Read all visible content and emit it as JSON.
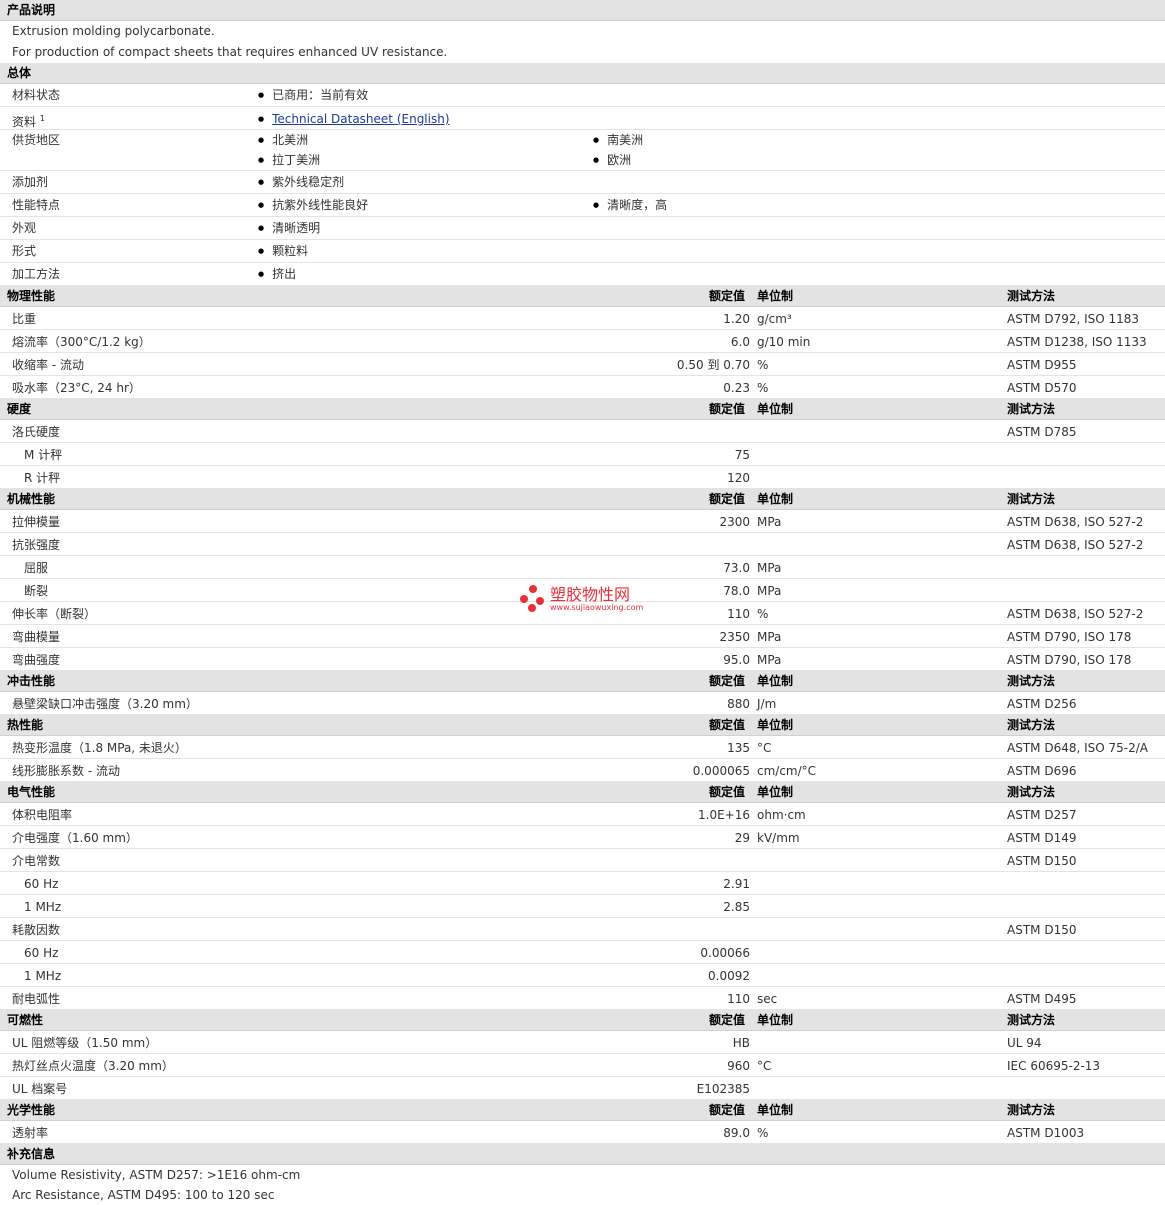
{
  "sections": {
    "desc": {
      "title": "产品说明",
      "lines": [
        "Extrusion molding polycarbonate.",
        "For production of compact sheets that requires enhanced UV resistance."
      ]
    },
    "general": {
      "title": "总体",
      "rows": [
        {
          "label": "材料状态",
          "items": [
            "已商用：当前有效"
          ]
        },
        {
          "label": "资料",
          "sup": "1",
          "link": "Technical Datasheet (English)"
        },
        {
          "label": "供货地区",
          "items": [
            "北美洲",
            "南美洲",
            "拉丁美洲",
            "欧洲"
          ]
        },
        {
          "label": "添加剂",
          "items": [
            "紫外线稳定剂"
          ]
        },
        {
          "label": "性能特点",
          "items": [
            "抗紫外线性能良好",
            "清晰度，高"
          ]
        },
        {
          "label": "外观",
          "items": [
            "清晰透明"
          ]
        },
        {
          "label": "形式",
          "items": [
            "颗粒料"
          ]
        },
        {
          "label": "加工方法",
          "items": [
            "挤出"
          ]
        }
      ]
    },
    "col_headers": {
      "value": "额定值",
      "unit": "单位制",
      "test": "测试方法"
    },
    "physical": {
      "title": "物理性能",
      "rows": [
        {
          "label": "比重",
          "value": "1.20",
          "unit": "g/cm³",
          "test": "ASTM D792, ISO 1183"
        },
        {
          "label": "熔流率（300°C/1.2 kg）",
          "value": "6.0",
          "unit": "g/10 min",
          "test": "ASTM D1238, ISO 1133"
        },
        {
          "label": "收缩率 - 流动",
          "value": "0.50 到 0.70",
          "unit": "%",
          "test": "ASTM D955"
        },
        {
          "label": "吸水率（23°C, 24 hr）",
          "value": "0.23",
          "unit": "%",
          "test": "ASTM D570"
        }
      ]
    },
    "hardness": {
      "title": "硬度",
      "rows": [
        {
          "label": "洛氏硬度",
          "test": "ASTM D785"
        },
        {
          "label": "M 计秤",
          "value": "75",
          "sub": true
        },
        {
          "label": "R 计秤",
          "value": "120",
          "sub": true
        }
      ]
    },
    "mechanical": {
      "title": "机械性能",
      "rows": [
        {
          "label": "拉伸模量",
          "value": "2300",
          "unit": "MPa",
          "test": "ASTM D638, ISO 527-2"
        },
        {
          "label": "抗张强度",
          "test": "ASTM D638, ISO 527-2"
        },
        {
          "label": "屈服",
          "value": "73.0",
          "unit": "MPa",
          "sub": true
        },
        {
          "label": "断裂",
          "value": "78.0",
          "unit": "MPa",
          "sub": true
        },
        {
          "label": "伸长率（断裂）",
          "value": "110",
          "unit": "%",
          "test": "ASTM D638, ISO 527-2"
        },
        {
          "label": "弯曲模量",
          "value": "2350",
          "unit": "MPa",
          "test": "ASTM D790, ISO 178"
        },
        {
          "label": "弯曲强度",
          "value": "95.0",
          "unit": "MPa",
          "test": "ASTM D790, ISO 178"
        }
      ]
    },
    "impact": {
      "title": "冲击性能",
      "rows": [
        {
          "label": "悬壁梁缺口冲击强度（3.20 mm）",
          "value": "880",
          "unit": "J/m",
          "test": "ASTM D256"
        }
      ]
    },
    "thermal": {
      "title": "热性能",
      "rows": [
        {
          "label": "热变形温度（1.8 MPa, 未退火）",
          "value": "135",
          "unit": "°C",
          "test": "ASTM D648, ISO 75-2/A"
        },
        {
          "label": "线形膨胀系数 - 流动",
          "value": "0.000065",
          "unit": "cm/cm/°C",
          "test": "ASTM D696"
        }
      ]
    },
    "electrical": {
      "title": "电气性能",
      "rows": [
        {
          "label": "体积电阻率",
          "value": "1.0E+16",
          "unit": "ohm·cm",
          "test": "ASTM D257"
        },
        {
          "label": "介电强度（1.60 mm）",
          "value": "29",
          "unit": "kV/mm",
          "test": "ASTM D149"
        },
        {
          "label": "介电常数",
          "test": "ASTM D150"
        },
        {
          "label": "60 Hz",
          "value": "2.91",
          "sub": true
        },
        {
          "label": "1 MHz",
          "value": "2.85",
          "sub": true
        },
        {
          "label": "耗散因数",
          "test": "ASTM D150"
        },
        {
          "label": "60 Hz",
          "value": "0.00066",
          "sub": true
        },
        {
          "label": "1 MHz",
          "value": "0.0092",
          "sub": true
        },
        {
          "label": "耐电弧性",
          "value": "110",
          "unit": "sec",
          "test": "ASTM D495"
        }
      ]
    },
    "flammability": {
      "title": "可燃性",
      "rows": [
        {
          "label": "UL 阻燃等级（1.50 mm）",
          "value": "HB",
          "test": "UL 94"
        },
        {
          "label": "热灯丝点火温度（3.20 mm）",
          "value": "960",
          "unit": "°C",
          "test": "IEC 60695-2-13"
        },
        {
          "label": "UL 档案号",
          "value": "E102385"
        }
      ]
    },
    "optical": {
      "title": "光学性能",
      "rows": [
        {
          "label": "透射率",
          "value": "89.0",
          "unit": "%",
          "test": "ASTM D1003"
        }
      ]
    },
    "supplement": {
      "title": "补充信息",
      "lines": [
        "Volume Resistivity, ASTM D257: >1E16 ohm-cm",
        "Arc Resistance, ASTM D495: 100 to 120 sec"
      ]
    }
  },
  "watermark": {
    "name": "塑胶物性网",
    "url": "www.sujiaowuxing.com"
  }
}
